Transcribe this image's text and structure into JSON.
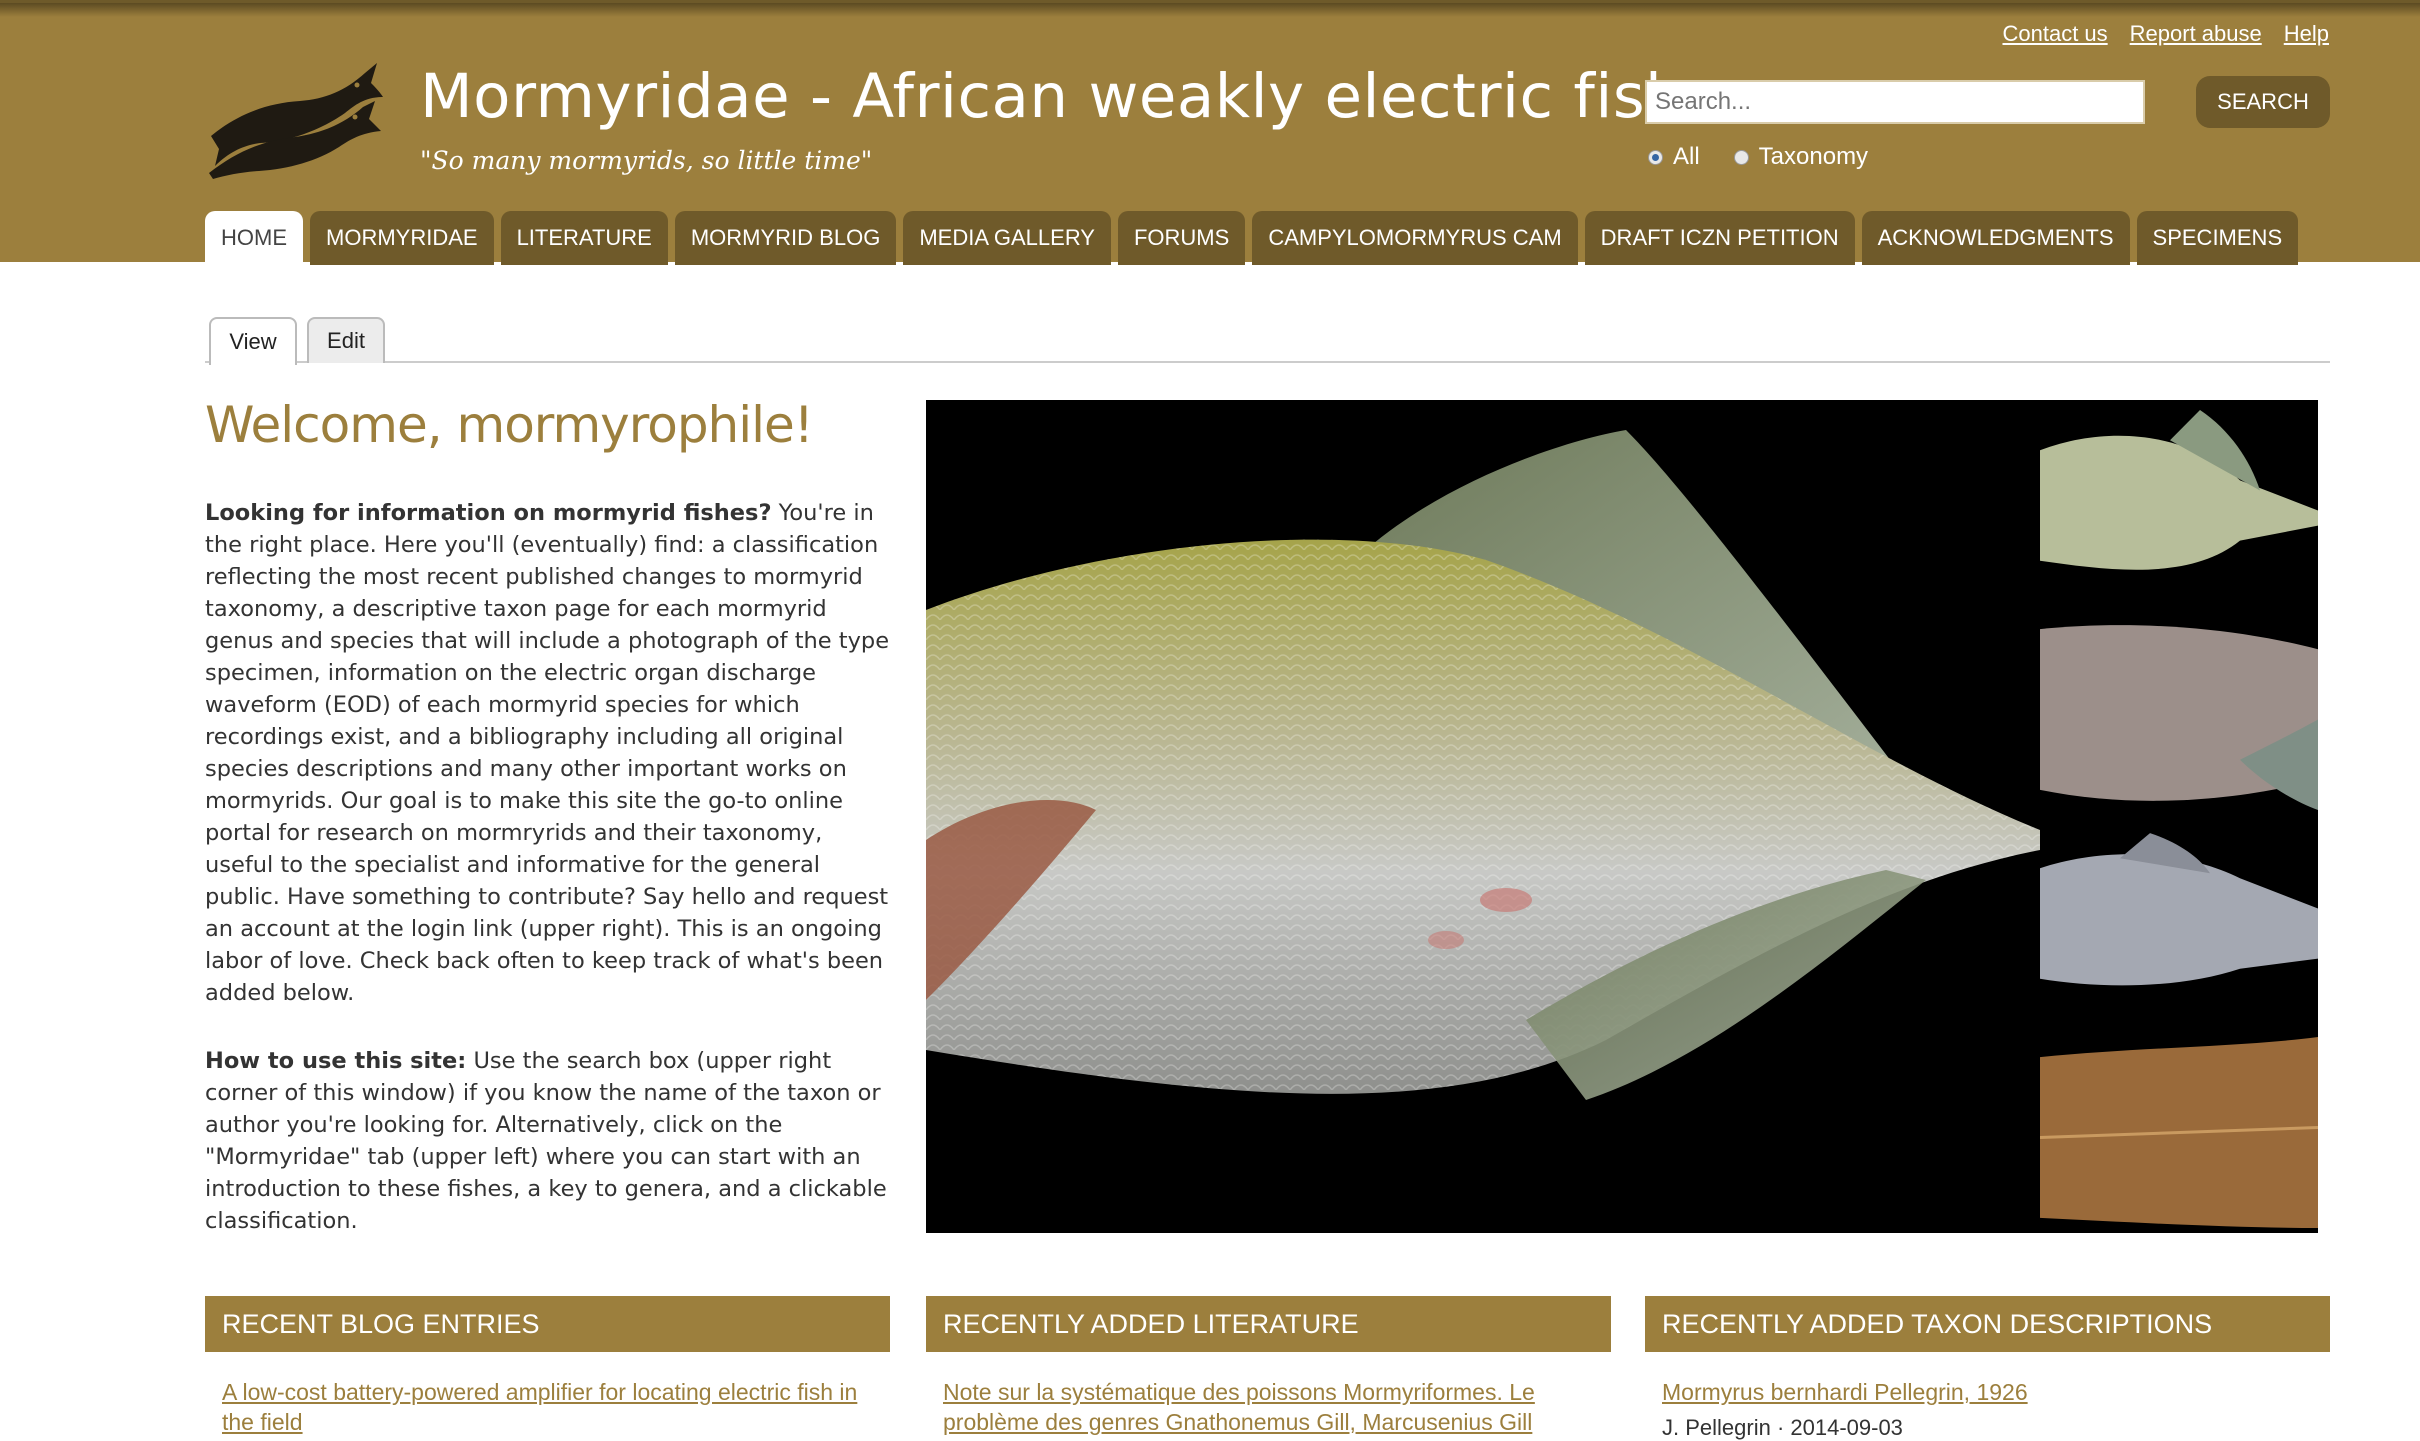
{
  "header": {
    "site_title": "Mormyridae - African weakly electric fishes",
    "slogan": "\"So many mormyrids, so little time\"",
    "top_links": [
      "Contact us",
      "Report abuse",
      "Help"
    ],
    "search": {
      "placeholder": "Search...",
      "button_label": "SEARCH"
    },
    "search_scope": [
      {
        "label": "All",
        "checked": true
      },
      {
        "label": "Taxonomy",
        "checked": false
      }
    ],
    "colors": {
      "header_bg": "#9c7f3d",
      "tab_bg": "#6f5a2a"
    }
  },
  "nav": {
    "tabs": [
      {
        "label": "HOME",
        "active": true
      },
      {
        "label": "MORMYRIDAE"
      },
      {
        "label": "LITERATURE"
      },
      {
        "label": "MORMYRID BLOG"
      },
      {
        "label": "MEDIA GALLERY"
      },
      {
        "label": "FORUMS"
      },
      {
        "label": "CAMPYLOMORMYRUS CAM"
      },
      {
        "label": "DRAFT ICZN PETITION"
      },
      {
        "label": "ACKNOWLEDGMENTS"
      },
      {
        "label": "SPECIMENS"
      }
    ]
  },
  "local_tabs": {
    "view": "View",
    "edit": "Edit"
  },
  "content": {
    "title": "Welcome, mormyrophile!",
    "para1_bold": "Looking for information on mormyrid fishes?",
    "para1_text": " You're in the right place. Here you'll (eventually) find: a classification reflecting the most recent published changes to mormyrid taxonomy, a descriptive taxon page for each mormyrid genus and species that will include a photograph of the type specimen, information on the electric organ discharge waveform (EOD) of each mormyrid species for which recordings exist, and a bibliography including all original species descriptions and many other important works on mormyrids. Our goal is to make this site the go-to online portal for research on mormryrids and their taxonomy, useful to the specialist and informative for the general public. Have something to contribute? Say hello and request an account at the login link (upper right). This is an ongoing labor of love. Check back often to keep track of what's been added below.",
    "para2_bold": "How to use this site:",
    "para2_text": " Use the search box (upper right corner of this window) if you know the name of the taxon or author you're looking for. Alternatively, click on the \"Mormyridae\" tab (upper left) where you can start with an introduction to these fishes, a key to genera, and a clickable classification."
  },
  "blocks": [
    {
      "heading": "RECENT BLOG ENTRIES",
      "link": "A low-cost battery-powered amplifier for locating electric fish in the field",
      "meta": ""
    },
    {
      "heading": "RECENTLY ADDED LITERATURE",
      "link": "Note sur la systématique des poissons Mormyriformes. Le problème des genres Gnathonemus Gill, Marcusenius Gill",
      "meta": ""
    },
    {
      "heading": "RECENTLY ADDED TAXON DESCRIPTIONS",
      "link": "Mormyrus bernhardi Pellegrin, 1926",
      "meta": "J. Pellegrin · 2014-09-03"
    }
  ]
}
